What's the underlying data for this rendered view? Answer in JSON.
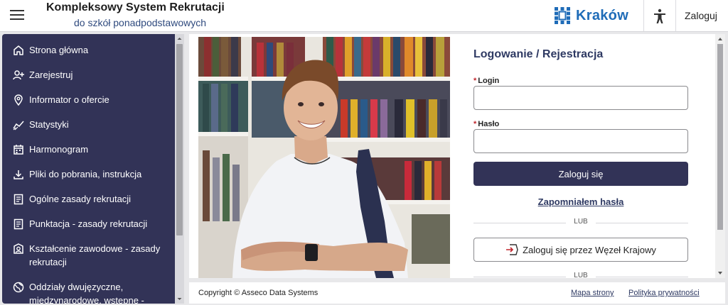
{
  "header": {
    "title": "Kompleksowy System Rekrutacji",
    "subtitle": "do szkół ponadpodstawowych",
    "logo_text": "Kraków",
    "login_label": "Zaloguj",
    "menu_icon": "hamburger-icon",
    "accessibility_icon": "accessibility-icon"
  },
  "sidebar": {
    "items": [
      {
        "label": "Strona główna",
        "icon": "home-icon"
      },
      {
        "label": "Zarejestruj",
        "icon": "add-user-icon"
      },
      {
        "label": "Informator o ofercie",
        "icon": "location-pin-icon"
      },
      {
        "label": "Statystyki",
        "icon": "chart-icon"
      },
      {
        "label": "Harmonogram",
        "icon": "calendar-icon"
      },
      {
        "label": "Pliki do pobrania, instrukcja",
        "icon": "download-icon"
      },
      {
        "label": "Ogólne zasady rekrutacji",
        "icon": "document-icon"
      },
      {
        "label": "Punktacja - zasady rekrutacji",
        "icon": "document-icon"
      },
      {
        "label": "Kształcenie zawodowe - zasady rekrutacji",
        "icon": "badge-icon"
      },
      {
        "label": "Oddziały dwujęzyczne, międzynarodowe, wstępne -",
        "icon": "globe-icon"
      }
    ]
  },
  "login_form": {
    "title": "Logowanie / Rejestracja",
    "login_label": "Login",
    "login_value": "",
    "password_label": "Hasło",
    "password_value": "",
    "required_marker": "*",
    "submit_label": "Zaloguj się",
    "forgot_label": "Zapomniałem hasła",
    "or_label": "LUB",
    "or_label_2": "LUB",
    "national_node_label": "Zaloguj się przez Węzeł Krajowy"
  },
  "footer": {
    "copyright": "Copyright © Asseco Data Systems",
    "sitemap_label": "Mapa strony",
    "privacy_label": "Polityka prywatności"
  },
  "colors": {
    "sidebar_bg": "#323357",
    "primary_button": "#323357",
    "accent_blue": "#1f6cb8",
    "required": "#c0262d"
  }
}
